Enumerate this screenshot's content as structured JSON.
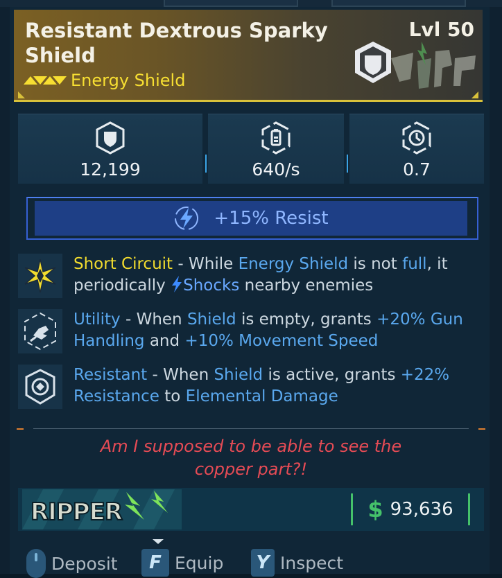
{
  "item": {
    "name": "Resistant Dextrous Sparky Shield",
    "level": "Lvl 50",
    "rarity_label": "Energy Shield",
    "type_icon": "shield-crest-icon",
    "manufacturer_art": "ripper-graffiti-art"
  },
  "stats": [
    {
      "icon": "shield-capacity-icon",
      "value": "12,199"
    },
    {
      "icon": "recharge-rate-icon",
      "value": "640/s"
    },
    {
      "icon": "recharge-delay-icon",
      "value": "0.7"
    }
  ],
  "banner": {
    "icon": "lightning-bolt-icon",
    "text": "+15% Resist"
  },
  "perks": [
    {
      "icon": "star-emblem-icon",
      "name": "Short Circuit",
      "dash": " - While ",
      "k1": "Energy Shield",
      "t2": " is not ",
      "k2": "full",
      "t3": ", it periodically ",
      "k3": "Shocks",
      "t4": " nearby enemies"
    },
    {
      "icon": "grabbing-hand-icon",
      "name": "Utility",
      "dash": " - When ",
      "k1": "Shield",
      "t2": " is empty, grants ",
      "k2": "+20% Gun Handling",
      "t3": " and ",
      "k3": "+10% Movement Speed",
      "t4": ""
    },
    {
      "icon": "shield-badge-icon",
      "name": "Resistant",
      "dash": " - When ",
      "k1": "Shield",
      "t2": " is active, grants ",
      "k2": "+22% Resistance",
      "t3": " to ",
      "k3": "Elemental Damage",
      "t4": ""
    }
  ],
  "flavor": {
    "line1": "Am I supposed to be able to see the",
    "line2": "copper part?!"
  },
  "footer": {
    "manufacturer_logo_text": "RIPPER",
    "price_symbol": "$",
    "price": "93,636"
  },
  "actions": [
    {
      "key": "",
      "key_icon": "mouse-icon",
      "label": "Deposit"
    },
    {
      "key": "F",
      "label": "Equip"
    },
    {
      "key": "Y",
      "label": "Inspect"
    }
  ],
  "colors": {
    "rarity": "#f7df32",
    "header_border": "#d8c13a",
    "keyword": "#5aa8ee",
    "flavor": "#e64b55",
    "price": "#45c26a"
  }
}
